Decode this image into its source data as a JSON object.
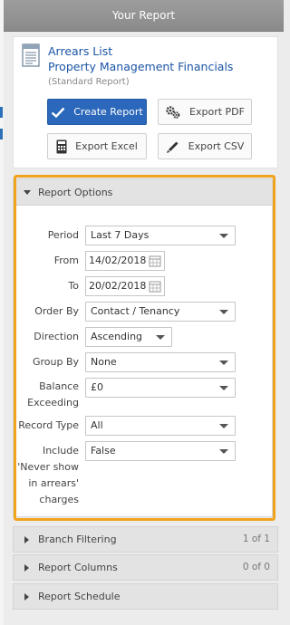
{
  "header": {
    "title": "Your Report"
  },
  "report": {
    "title_line1": "Arrears List",
    "title_line2": "Property Management Financials",
    "subtitle": "(Standard Report)",
    "icon": "report-document-icon"
  },
  "actions": {
    "create_report": "Create Report",
    "export_pdf": "Export PDF",
    "export_excel": "Export Excel",
    "export_csv": "Export CSV"
  },
  "report_options": {
    "heading": "Report Options",
    "period": {
      "label": "Period",
      "value": "Last 7 Days"
    },
    "from": {
      "label": "From",
      "value": "14/02/2018"
    },
    "to": {
      "label": "To",
      "value": "20/02/2018"
    },
    "order_by": {
      "label": "Order By",
      "value": "Contact / Tenancy"
    },
    "direction": {
      "label": "Direction",
      "value": "Ascending"
    },
    "group_by": {
      "label": "Group By",
      "value": "None"
    },
    "balance_exceeding": {
      "label_line1": "Balance",
      "label_line2": "Exceeding",
      "value": "£0"
    },
    "record_type": {
      "label": "Record Type",
      "value": "All"
    },
    "include_never_show": {
      "label_line1": "Include",
      "label_line2": "'Never show",
      "label_line3": "in arrears'",
      "label_line4": "charges",
      "value": "False"
    }
  },
  "sections": [
    {
      "label": "Branch Filtering",
      "count": "1 of 1"
    },
    {
      "label": "Report Columns",
      "count": "0 of 0"
    },
    {
      "label": "Report Schedule",
      "count": ""
    }
  ],
  "colors": {
    "primary_button": "#2b67ba",
    "link_text": "#1b55a5",
    "highlight_border": "#f0a41e",
    "header_bar": "#959595"
  }
}
